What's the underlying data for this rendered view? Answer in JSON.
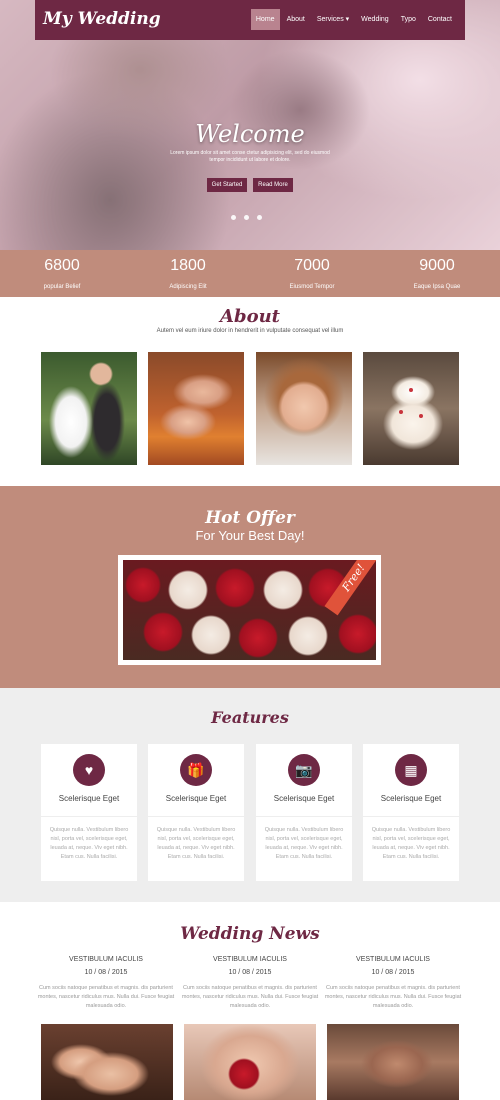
{
  "brand": {
    "logo": "My Wedding"
  },
  "nav": {
    "items": [
      "Home",
      "About",
      "Services ▾",
      "Wedding",
      "Typo",
      "Contact"
    ],
    "active": "Home"
  },
  "hero": {
    "title": "Welcome",
    "text": "Lorem ipsum dolor sit amet conse ctetur adipisicing elit, sed do eiusmod tempor incididunt ut labore et dolore.",
    "btn_primary": "Get Started",
    "btn_secondary": "Read More",
    "slides": 3
  },
  "stats": [
    {
      "value": "6800",
      "label": "popular Belief"
    },
    {
      "value": "1800",
      "label": "Adipiscing Elit"
    },
    {
      "value": "7000",
      "label": "Eiusmod Tempor"
    },
    {
      "value": "9000",
      "label": "Eaque Ipsa Quae"
    }
  ],
  "about": {
    "title": "About",
    "subtitle": "Autem vel eum iriure dolor in hendrerit in vulputate consequat vel illum"
  },
  "offer": {
    "title": "Hot Offer",
    "subtitle": "For Your Best Day!",
    "ribbon": "Free!"
  },
  "features": {
    "title": "Features",
    "items": [
      {
        "icon": "heart-icon",
        "glyph": "♥",
        "title": "Scelerisque Eget",
        "text": "Quisque nulla. Vestibulum libero nisl, porta vel, scelerisque eget, leuada at, neque. Viv eget nibh. Etam cus. Nulla facilisi."
      },
      {
        "icon": "gift-icon",
        "glyph": "🎁",
        "title": "Scelerisque Eget",
        "text": "Quisque nulla. Vestibulum libero nisl, porta vel, scelerisque eget, leuada at, neque. Viv eget nibh. Etam cus. Nulla facilisi."
      },
      {
        "icon": "camera-icon",
        "glyph": "📷",
        "title": "Scelerisque Eget",
        "text": "Quisque nulla. Vestibulum libero nisl, porta vel, scelerisque eget, leuada at, neque. Viv eget nibh. Etam cus. Nulla facilisi."
      },
      {
        "icon": "calendar-icon",
        "glyph": "▦",
        "title": "Scelerisque Eget",
        "text": "Quisque nulla. Vestibulum libero nisl, porta vel, scelerisque eget, leuada at, neque. Viv eget nibh. Etam cus. Nulla facilisi."
      }
    ]
  },
  "news": {
    "title": "Wedding News",
    "items": [
      {
        "title": "VESTIBULUM IACULIS",
        "date": "10 / 08 / 2015",
        "text": "Cum sociis natoque penatibus et magnis. dis parturient montes, nascetur ridiculus mus. Nulla dui. Fusce feugiat malesuada odio."
      },
      {
        "title": "VESTIBULUM IACULIS",
        "date": "10 / 08 / 2015",
        "text": "Cum sociis natoque penatibus et magnis. dis parturient montes, nascetur ridiculus mus. Nulla dui. Fusce feugiat malesuada odio."
      },
      {
        "title": "VESTIBULUM IACULIS",
        "date": "10 / 08 / 2015",
        "text": "Cum sociis natoque penatibus et magnis. dis parturient montes, nascetur ridiculus mus. Nulla dui. Fusce feugiat malesuada odio."
      }
    ]
  },
  "colors": {
    "brand": "#6e2844",
    "accent": "#c08c7c",
    "ribbon": "#e0533a",
    "nav_active": "#b9838f"
  }
}
